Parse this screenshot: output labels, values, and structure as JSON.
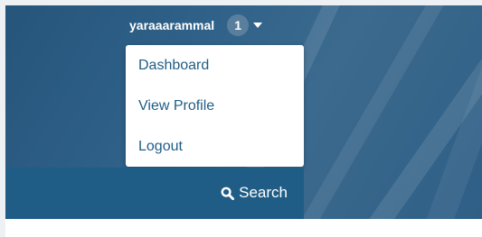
{
  "header": {
    "username": "yaraaarammal",
    "notification_count": "1"
  },
  "user_menu": {
    "items": [
      {
        "label": "Dashboard"
      },
      {
        "label": "View Profile"
      },
      {
        "label": "Logout"
      }
    ]
  },
  "search": {
    "label": "Search"
  },
  "icons": {
    "search": "search-icon",
    "menu_caret": "caret-down-icon"
  },
  "colors": {
    "link": "#1f5d86",
    "search_band": "#1f5d86",
    "badge": "#5a7f9d"
  }
}
